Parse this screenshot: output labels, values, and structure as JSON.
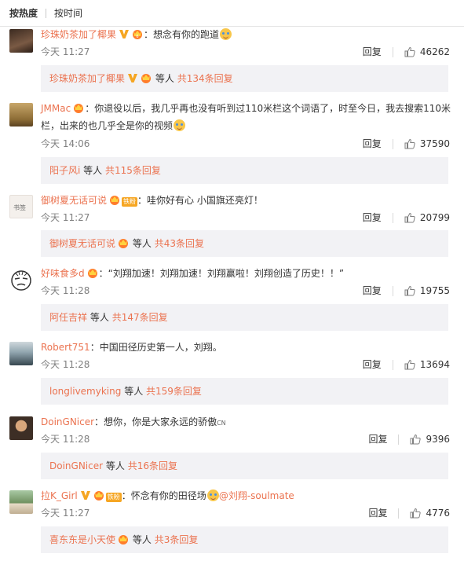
{
  "sort": {
    "hot": "按热度",
    "time": "按时间"
  },
  "comments": [
    {
      "user": "珍珠奶茶加了椰果",
      "colon": "：",
      "text": "想念有你的跑道",
      "time": "今天 11:27",
      "reply": "回复",
      "likes": "46262",
      "sub_user": "珍珠奶茶加了椰果",
      "sub_mid": "等人",
      "sub_total": "共134条回复"
    },
    {
      "user": "JMMac",
      "colon": "：",
      "text": "你退役以后，我几乎再也没有听到过110米栏这个词语了，时至今日，我去搜索110米栏，出来的也几乎全是你的视频",
      "time": "今天 14:06",
      "reply": "回复",
      "likes": "37590",
      "sub_user": "阳子风i",
      "sub_mid": "等人",
      "sub_total": "共115条回复"
    },
    {
      "user": "御树夏无话可说",
      "fan": "铁粉",
      "colon": "：",
      "text": "哇你好有心  小国旗还亮灯！",
      "time": "今天 11:27",
      "reply": "回复",
      "likes": "20799",
      "sub_user": "御树夏无话可说",
      "sub_mid": "等人",
      "sub_total": "共43条回复"
    },
    {
      "user": "好味食多d",
      "colon": "：",
      "text": "“刘翔加速！刘翔加速！刘翔赢啦！刘翔创造了历史！！”",
      "time": "今天 11:28",
      "reply": "回复",
      "likes": "19755",
      "sub_user": "阿任吉祥",
      "sub_mid": "等人",
      "sub_total": "共147条回复"
    },
    {
      "user": "Robert751",
      "colon": "：",
      "text": "中国田径历史第一人，刘翔。",
      "time": "今天 11:28",
      "reply": "回复",
      "likes": "13694",
      "sub_user": "longlivemyking",
      "sub_mid": "等人",
      "sub_total": "共159条回复"
    },
    {
      "user": "DoinGNicer",
      "colon": "：",
      "text": "想你，你是大家永远的骄傲",
      "suffix": "CN",
      "time": "今天 11:28",
      "reply": "回复",
      "likes": "9396",
      "sub_user": "DoinGNicer",
      "sub_mid": "等人",
      "sub_total": "共16条回复"
    },
    {
      "user": "拉K_Girl",
      "fan": "铁粉",
      "colon": "：",
      "text": "怀念有你的田径场",
      "mention": "@刘翔-soulmate",
      "time": "今天 11:27",
      "reply": "回复",
      "likes": "4776",
      "sub_user": "喜东东是小天使",
      "sub_mid": "等人",
      "sub_total": "共3条回复"
    }
  ],
  "colors": {
    "link": "#eb7350",
    "muted": "#808080",
    "subbg": "#f2f2f5"
  }
}
